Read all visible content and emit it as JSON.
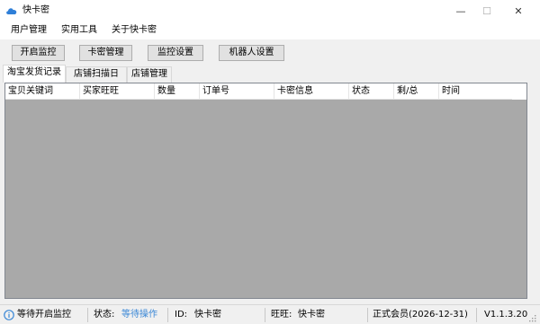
{
  "window": {
    "title": "快卡密",
    "minimize_glyph": "—",
    "maximize_glyph": "☐",
    "close_glyph": "✕"
  },
  "menu": {
    "items": [
      {
        "label": "用户管理"
      },
      {
        "label": "实用工具"
      },
      {
        "label": "关于快卡密"
      }
    ]
  },
  "toolbar": {
    "buttons": [
      {
        "label": "开启监控"
      },
      {
        "label": "卡密管理"
      },
      {
        "label": "监控设置"
      },
      {
        "label": "机器人设置"
      }
    ]
  },
  "tabs": [
    {
      "label": "淘宝发货记录",
      "active": true
    },
    {
      "label": "店铺扫描日志",
      "active": false
    },
    {
      "label": "店铺管理",
      "active": false
    }
  ],
  "table": {
    "columns": [
      {
        "label": "宝贝关键词"
      },
      {
        "label": "买家旺旺"
      },
      {
        "label": "数量"
      },
      {
        "label": "订单号"
      },
      {
        "label": "卡密信息"
      },
      {
        "label": "状态"
      },
      {
        "label": "剩/总"
      },
      {
        "label": "时间"
      }
    ],
    "rows": []
  },
  "status": {
    "monitor_text": "等待开启监控",
    "state_label": "状态:",
    "state_value": "等待操作",
    "id_label": "ID:",
    "id_value": "快卡密",
    "wangwang_label": "旺旺:",
    "wangwang_value": "快卡密",
    "membership": "正式会员(2026-12-31)",
    "version": "V1.1.3.20"
  },
  "colors": {
    "accent": "#3a87d6",
    "grid_background": "#a9a9a9"
  }
}
